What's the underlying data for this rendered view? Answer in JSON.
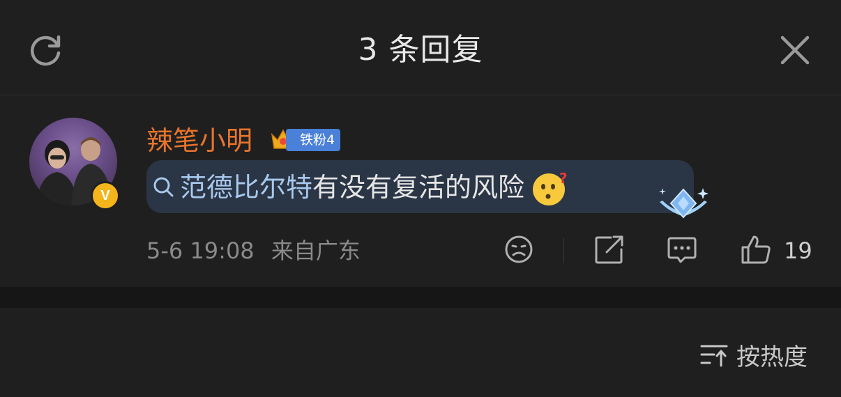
{
  "header": {
    "title": "3 条回复",
    "refresh_icon": "refresh-icon",
    "close_icon": "close-icon"
  },
  "comment": {
    "username": "辣笔小明",
    "username_color": "#e8742c",
    "fan_badge": {
      "label": "铁粉4",
      "icon": "crown-icon"
    },
    "verified_badge": "V",
    "message": {
      "link_text": "范德比尔特",
      "text": "有没有复活的风险",
      "emoji": "thinking-face-emoji"
    },
    "timestamp": "5-6 19:08",
    "location": "来自广东",
    "actions": {
      "dislike_icon": "sad-face-icon",
      "share_icon": "share-icon",
      "reply_icon": "comment-icon",
      "like_icon": "thumbs-up-icon",
      "like_count": "19"
    }
  },
  "sort": {
    "label": "按热度",
    "icon": "sort-icon"
  },
  "colors": {
    "background": "#1f1f1f",
    "link": "#a8c8ec",
    "bubble": "#2a3545"
  }
}
